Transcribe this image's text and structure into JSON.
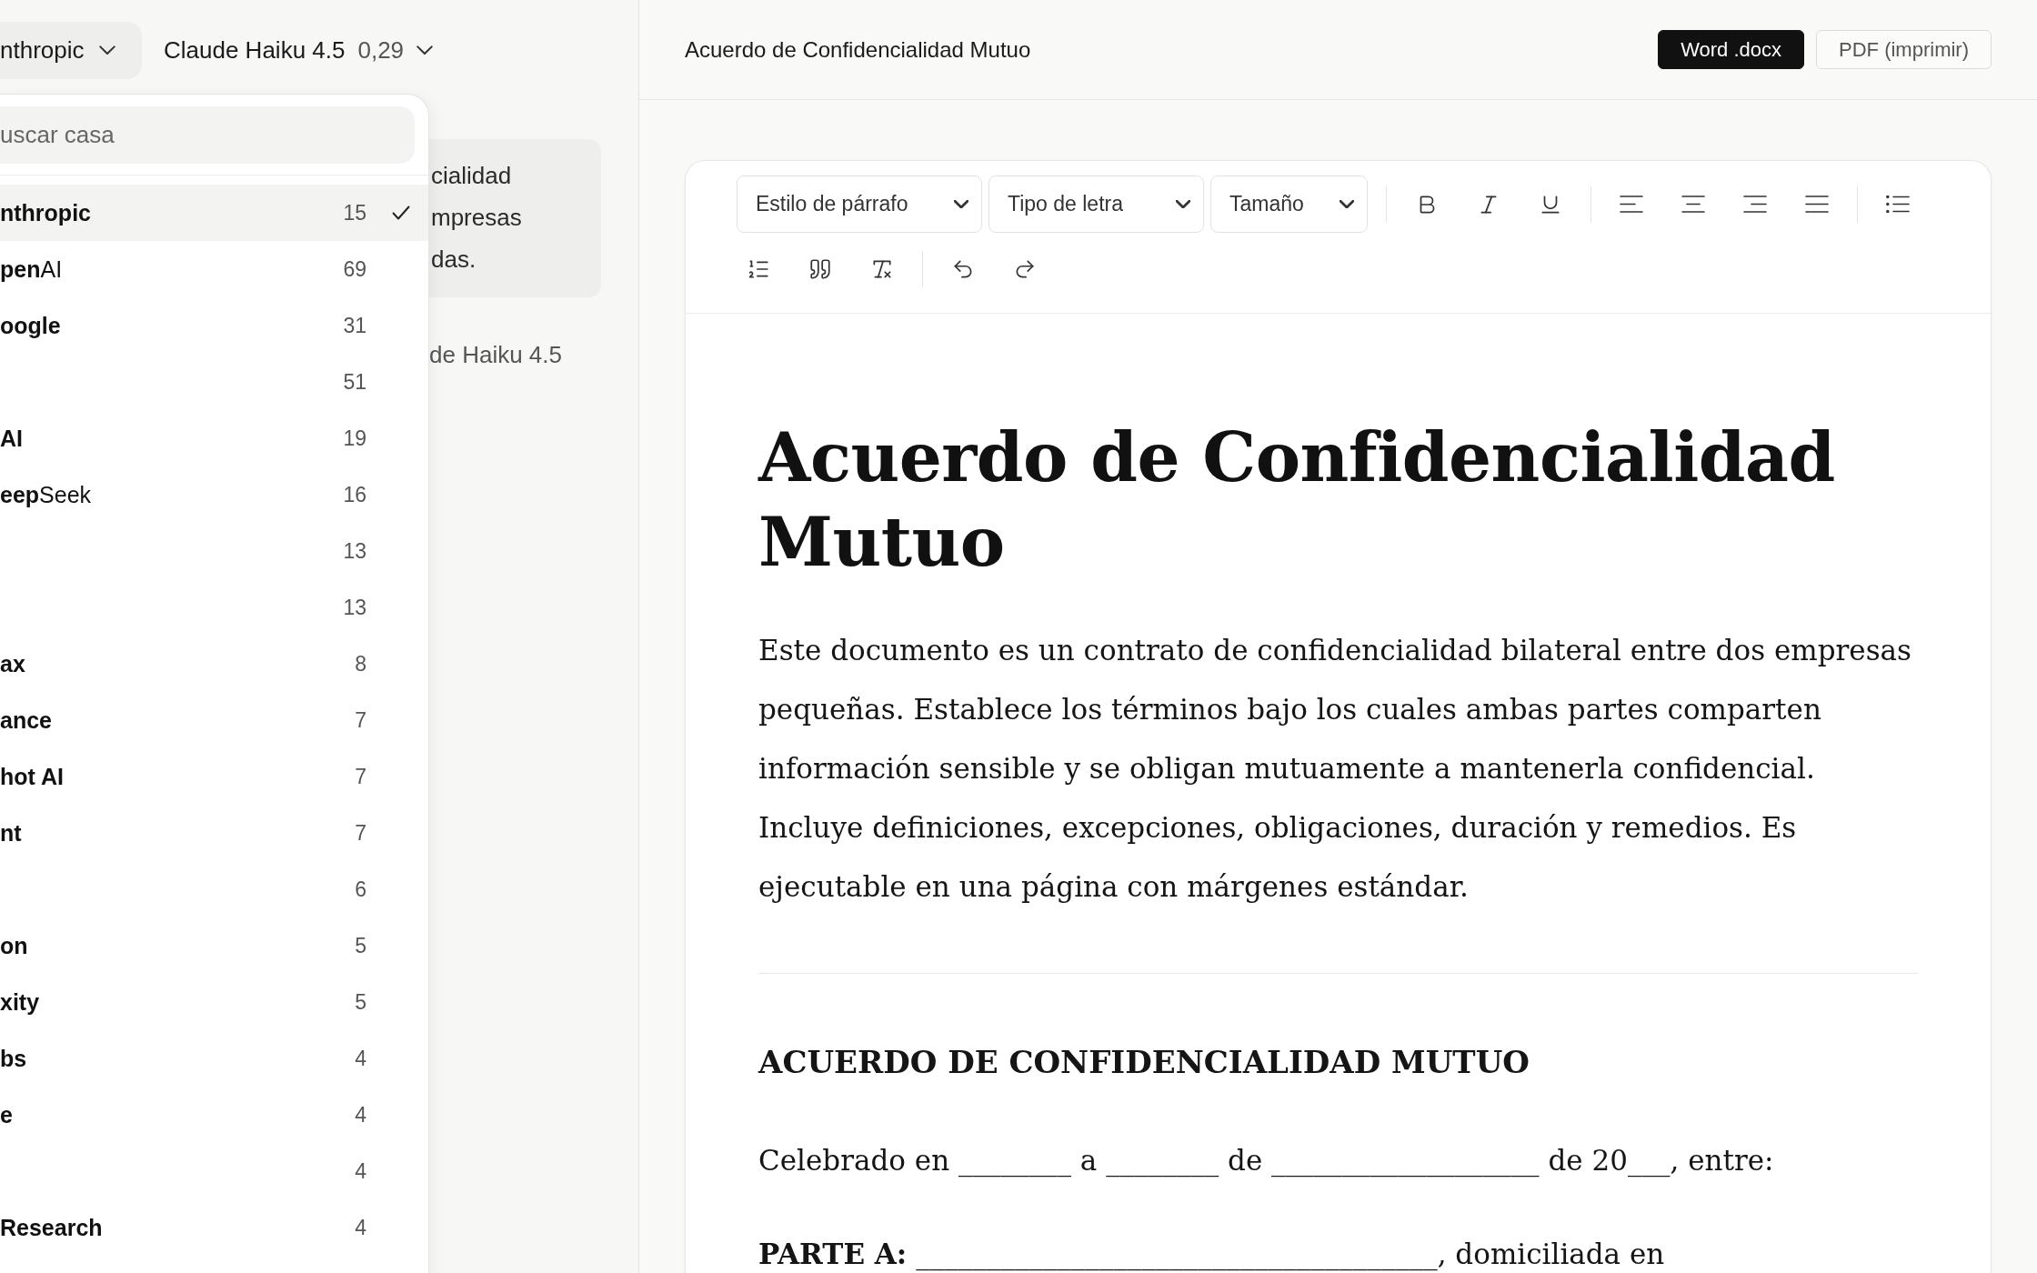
{
  "provider_button": {
    "label": "nthropic"
  },
  "model_selector": {
    "name": "Claude Haiku 4.5",
    "price": "0,29"
  },
  "background_card": {
    "lines": [
      "cialidad",
      "mpresas",
      "das."
    ]
  },
  "background_model": {
    "label": "de Haiku 4.5"
  },
  "provider_menu": {
    "search": {
      "placeholder": "uscar casa"
    },
    "items": [
      {
        "name": "nthropic",
        "kind": "plain",
        "count": "15",
        "selected": true
      },
      {
        "name": "**pen**AI",
        "kind": "mixed",
        "count": "69",
        "selected": false
      },
      {
        "name": "oogle",
        "kind": "plain",
        "count": "31",
        "selected": false
      },
      {
        "kind": "plain",
        "count": "51",
        "selected": false
      },
      {
        "name": "AI",
        "kind": "plain",
        "count": "19",
        "selected": false
      },
      {
        "name": "**eep**Seek",
        "kind": "mixed",
        "count": "16",
        "selected": false
      },
      {
        "kind": "plain",
        "count": "13",
        "selected": false
      },
      {
        "kind": "plain",
        "count": "13",
        "selected": false
      },
      {
        "name": "ax",
        "kind": "plain",
        "count": "8",
        "selected": false
      },
      {
        "name": "ance",
        "kind": "plain",
        "count": "7",
        "selected": false
      },
      {
        "name": "hot AI",
        "kind": "plain",
        "count": "7",
        "selected": false
      },
      {
        "name": "nt",
        "kind": "plain",
        "count": "7",
        "selected": false
      },
      {
        "kind": "plain",
        "count": "6",
        "selected": false
      },
      {
        "name": "on",
        "kind": "plain",
        "count": "5",
        "selected": false
      },
      {
        "name": "xity",
        "kind": "plain",
        "count": "5",
        "selected": false
      },
      {
        "name": "bs",
        "kind": "plain",
        "count": "4",
        "selected": false
      },
      {
        "name": "e",
        "kind": "plain",
        "count": "4",
        "selected": false
      },
      {
        "kind": "plain",
        "count": "4",
        "selected": false
      },
      {
        "name": "Research",
        "kind": "plain",
        "count": "4",
        "selected": false
      }
    ]
  },
  "header": {
    "title": "Acuerdo de Confidencialidad Mutuo",
    "buttons": [
      {
        "label": "Word .docx",
        "kind": "primary"
      },
      {
        "label": "PDF (imprimir)",
        "kind": "outline"
      }
    ]
  },
  "toolbar": {
    "selects": [
      {
        "label": "Estilo de párrafo"
      },
      {
        "label": "Tipo de letra"
      },
      {
        "label": "Tamaño"
      }
    ]
  },
  "document": {
    "title": "Acuerdo de Confidencialidad Mutuo",
    "summary": "Este documento es un contrato de confidencialidad bilateral entre dos empresas pequeñas. Establece los términos bajo los cuales ambas partes comparten información sensible y se obligan mutuamente a mantenerla confidencial. Incluye definiciones, excepciones, obligaciones, duración y remedios. Es ejecutable en una página con márgenes estándar.",
    "heading": "ACUERDO DE CONFIDENCIALIDAD MUTUO",
    "paragraphs": [
      "Celebrado en ________ a ________ de ___________________ de 20___, entre:",
      "**PARTE A:** _____________________________________, domiciliada en"
    ]
  }
}
